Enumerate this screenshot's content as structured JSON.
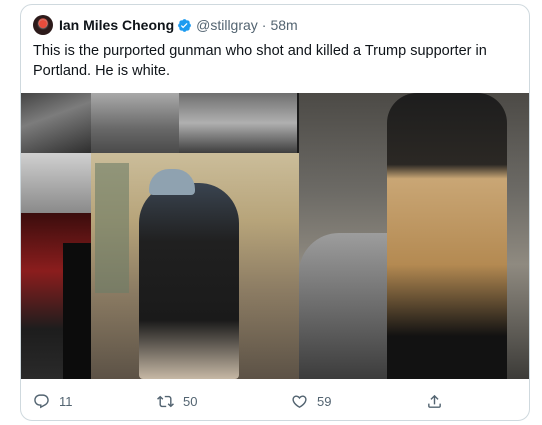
{
  "tweet": {
    "author_name": "Ian Miles Cheong",
    "handle": "@stillgray",
    "separator": "·",
    "time": "58m",
    "text": "This is the purported gunman who shot and killed a Trump supporter in Portland. He is white."
  },
  "actions": {
    "reply_count": "11",
    "retweet_count": "50",
    "like_count": "59"
  },
  "colors": {
    "verified": "#1d9bf0",
    "secondary_text": "#536471",
    "border": "#cfd9de"
  },
  "icons": [
    "verified-badge-icon",
    "reply-icon",
    "retweet-icon",
    "like-icon",
    "share-icon"
  ]
}
